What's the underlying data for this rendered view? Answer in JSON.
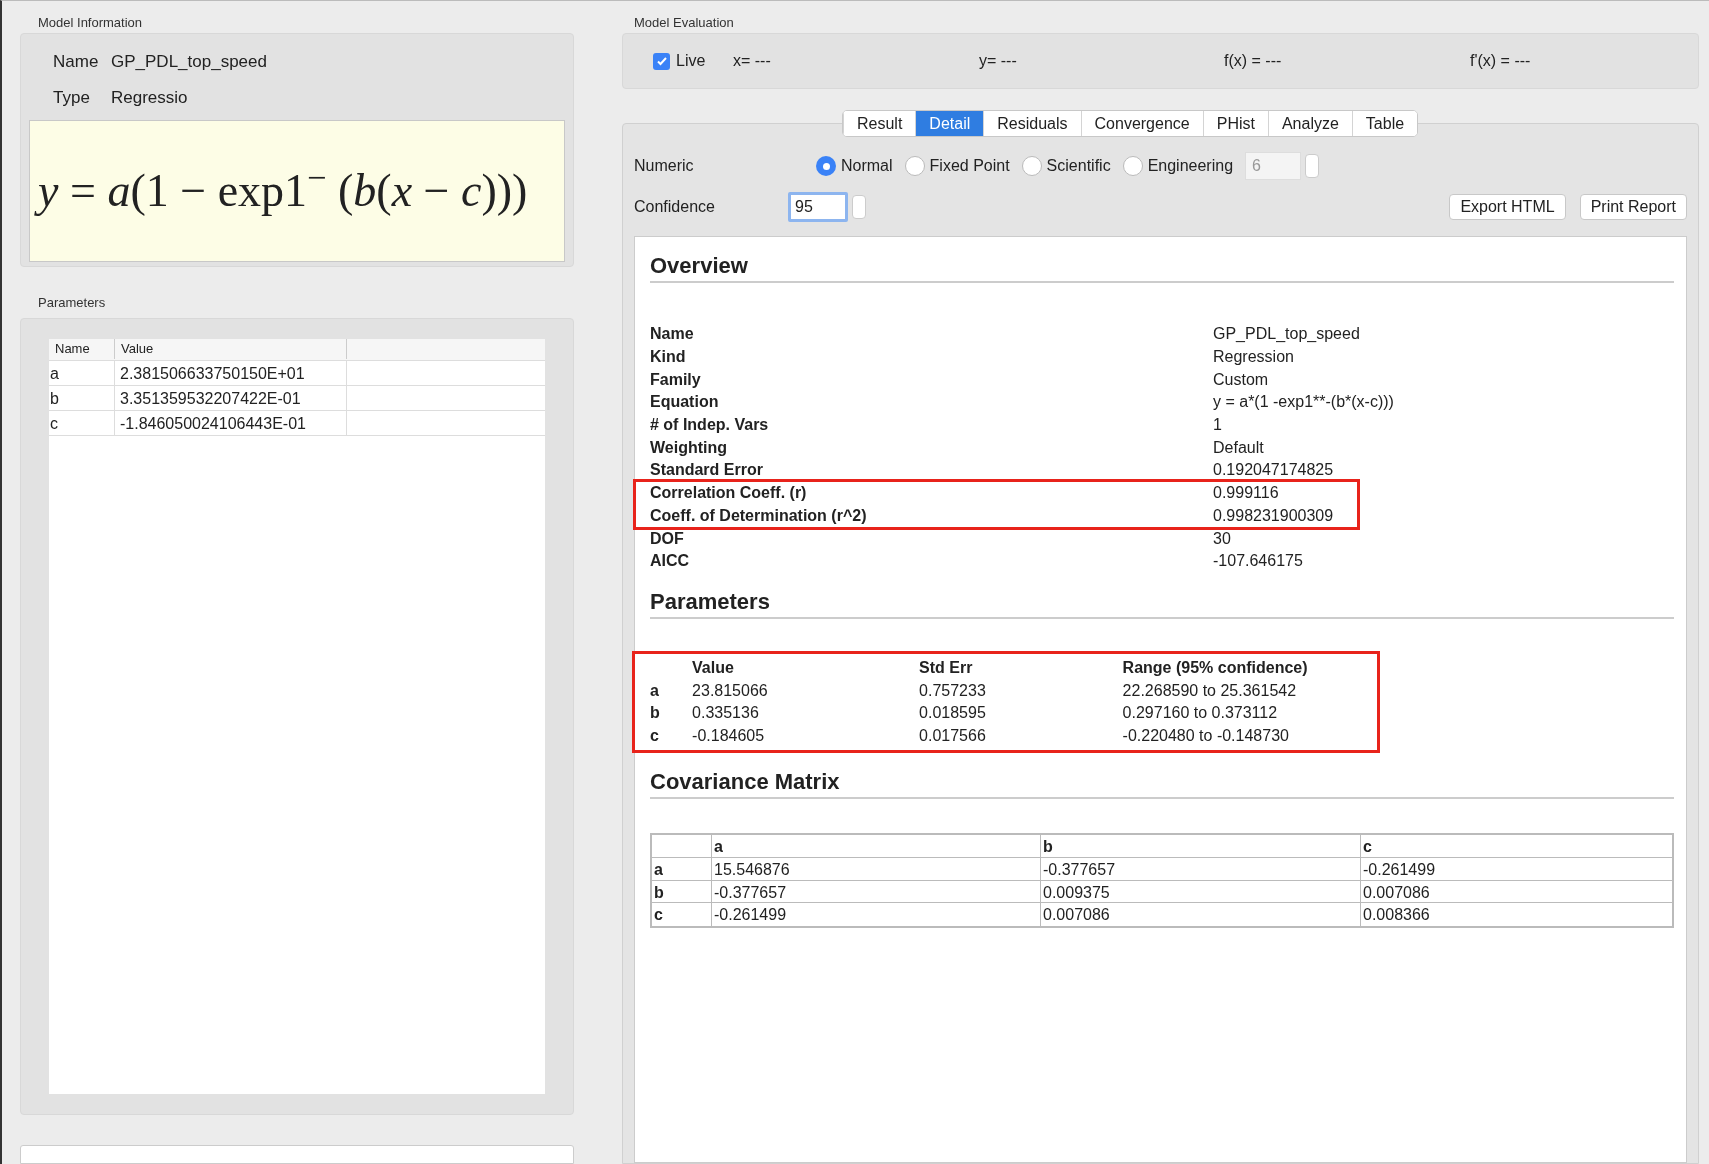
{
  "model_information": {
    "title": "Model Information",
    "fields": [
      {
        "label": "Name",
        "value": "GP_PDL_top_speed"
      },
      {
        "label": "Type",
        "value": "Regressio"
      }
    ],
    "equation": "*y* = *a*(1 − exp1$^{−}$ (*b*(*x* − *c*)))"
  },
  "parameters_panel": {
    "title": "Parameters",
    "columns": [
      "Name",
      "Value"
    ],
    "rows": [
      [
        "a",
        "2.381506633750150E+01"
      ],
      [
        "b",
        "3.351359532207422E-01"
      ],
      [
        "c",
        "-1.846050024106443E-01"
      ]
    ]
  },
  "model_evaluation": {
    "title": "Model Evaluation",
    "live": {
      "label": "Live",
      "checked": true
    },
    "readouts": [
      "x= ---",
      "y= ---",
      "f(x) = ---",
      "f'(x) = ---"
    ]
  },
  "tabs": [
    {
      "label": "Result",
      "selected": false
    },
    {
      "label": "Detail",
      "selected": true
    },
    {
      "label": "Residuals",
      "selected": false
    },
    {
      "label": "Convergence",
      "selected": false
    },
    {
      "label": "PHist",
      "selected": false
    },
    {
      "label": "Analyze",
      "selected": false
    },
    {
      "label": "Table",
      "selected": false
    }
  ],
  "numeric": {
    "label": "Numeric",
    "options": [
      {
        "label": "Normal",
        "selected": true
      },
      {
        "label": "Fixed Point",
        "selected": false
      },
      {
        "label": "Scientific",
        "selected": false
      },
      {
        "label": "Engineering",
        "selected": false
      }
    ],
    "digits": "6"
  },
  "confidence": {
    "label": "Confidence",
    "value": "95"
  },
  "buttons": [
    "Export HTML",
    "Print Report"
  ],
  "report": {
    "overview": {
      "title": "Overview",
      "rows": [
        {
          "label": "Name",
          "value": "GP_PDL_top_speed",
          "highlighted": false
        },
        {
          "label": "Kind",
          "value": "Regression",
          "highlighted": false
        },
        {
          "label": "Family",
          "value": "Custom",
          "highlighted": false
        },
        {
          "label": "Equation",
          "value": "y = a*(1 -exp1**-(b*(x-c)))",
          "highlighted": false
        },
        {
          "label": "# of Indep. Vars",
          "value": "1",
          "highlighted": false
        },
        {
          "label": "Weighting",
          "value": "Default",
          "highlighted": false
        },
        {
          "label": "Standard Error",
          "value": "0.192047174825",
          "highlighted": false
        },
        {
          "label": "Correlation Coeff. (r)",
          "value": "0.999116",
          "highlighted": true
        },
        {
          "label": "Coeff. of Determination (r^2)",
          "value": "0.998231900309",
          "highlighted": true
        },
        {
          "label": "DOF",
          "value": "30",
          "highlighted": false
        },
        {
          "label": "AICC",
          "value": "-107.646175",
          "highlighted": false
        }
      ]
    },
    "parameters": {
      "title": "Parameters",
      "highlighted": true,
      "columns": [
        "Value",
        "Std Err",
        "Range (95% confidence)"
      ],
      "rows": [
        {
          "name": "a",
          "cells": [
            "23.815066",
            "0.757233",
            "22.268590 to 25.361542"
          ]
        },
        {
          "name": "b",
          "cells": [
            "0.335136",
            "0.018595",
            "0.297160 to 0.373112"
          ]
        },
        {
          "name": "c",
          "cells": [
            "-0.184605",
            "0.017566",
            "-0.220480 to -0.148730"
          ]
        }
      ]
    },
    "covariance": {
      "title": "Covariance Matrix",
      "columns": [
        "a",
        "b",
        "c"
      ],
      "rows": [
        {
          "name": "a",
          "cells": [
            "15.546876",
            "-0.377657",
            "-0.261499"
          ]
        },
        {
          "name": "b",
          "cells": [
            "-0.377657",
            "0.009375",
            "0.007086"
          ]
        },
        {
          "name": "c",
          "cells": [
            "-0.261499",
            "0.007086",
            "0.008366"
          ]
        }
      ]
    }
  }
}
